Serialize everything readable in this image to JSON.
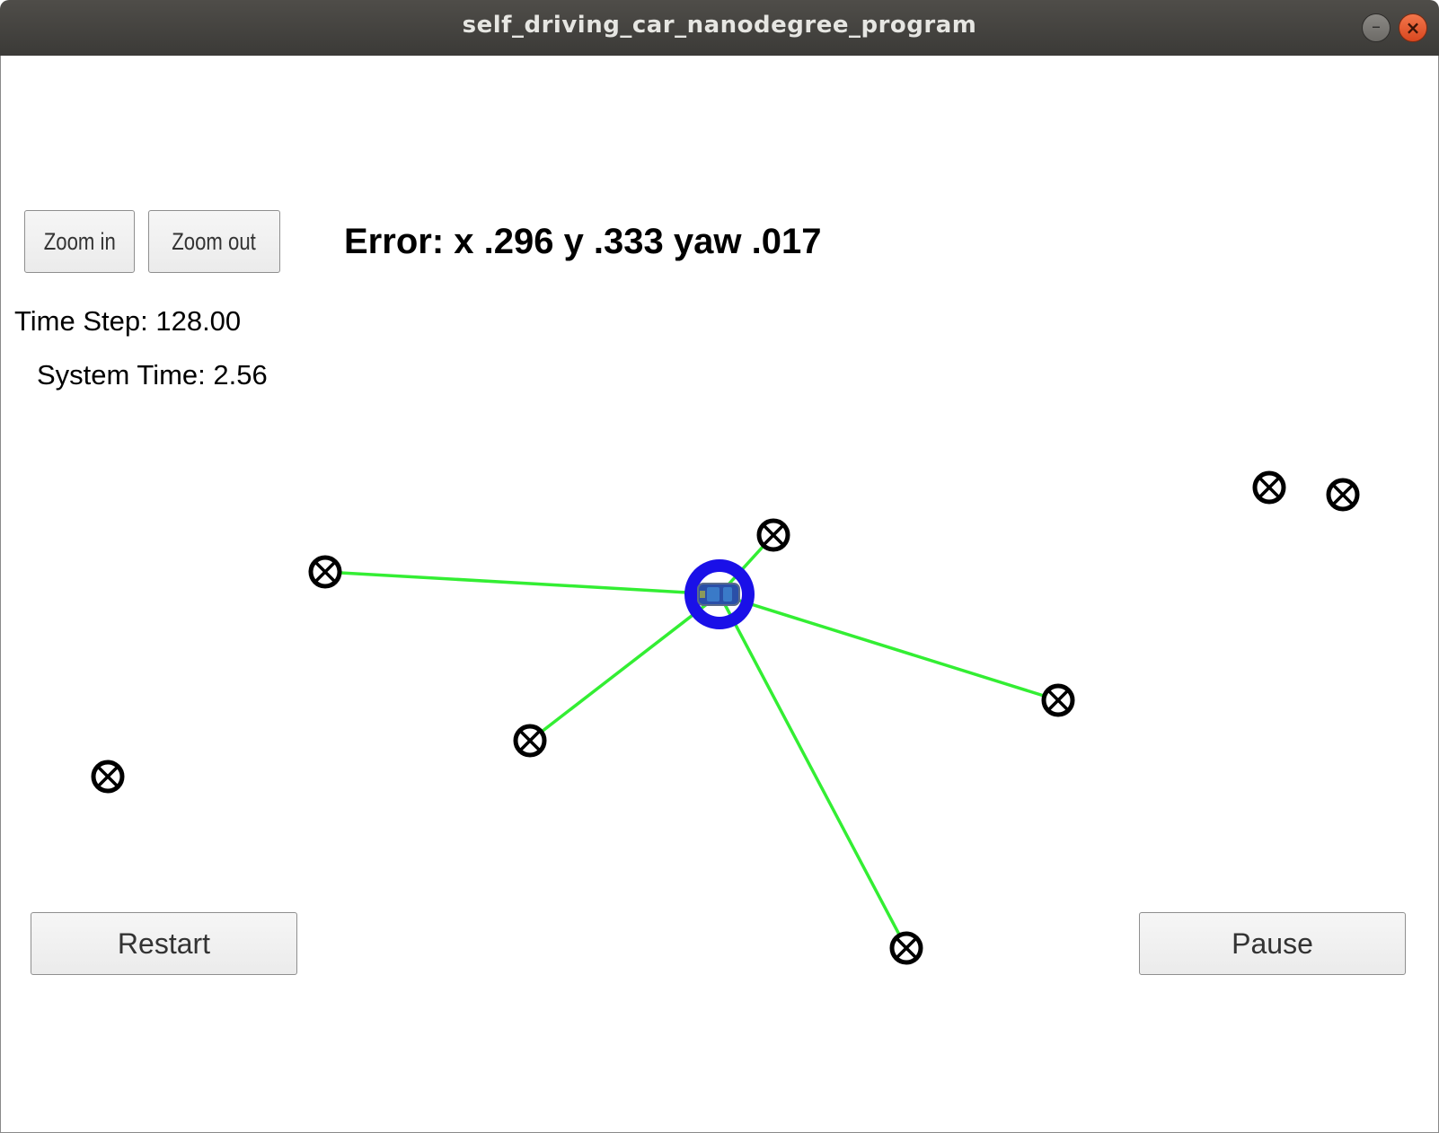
{
  "window": {
    "title": "self_driving_car_nanodegree_program",
    "minimize_glyph": "–",
    "close_glyph": "×"
  },
  "controls": {
    "zoom_in_label": "Zoom in",
    "zoom_out_label": "Zoom out",
    "restart_label": "Restart",
    "pause_label": "Pause"
  },
  "status": {
    "error_text": "Error: x .296 y .333 yaw .017",
    "time_step_text": "Time Step: 128.00",
    "system_time_text": "System Time: 2.56"
  },
  "scene": {
    "colors": {
      "observation_line": "#33ee33",
      "vehicle_ring": "#1a10e8",
      "landmark": "#000000"
    },
    "icons": {
      "landmark": "landmark-x-circle-icon",
      "vehicle": "car-icon"
    }
  }
}
